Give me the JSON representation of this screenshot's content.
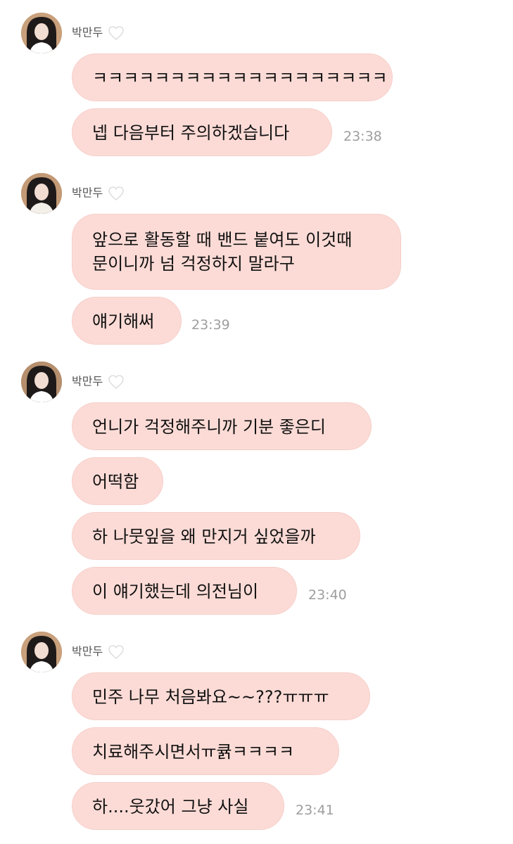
{
  "groups": [
    {
      "sender": "박만두",
      "messages": [
        {
          "text": "ㅋㅋㅋㅋㅋㅋㅋㅋㅋㅋㅋㅋㅋㅋㅋㅋㅋㅋㅋ"
        },
        {
          "text": "넵 다음부터 주의하겠습니다",
          "time": "23:38"
        }
      ]
    },
    {
      "sender": "박만두",
      "messages": [
        {
          "line1": "앞으로 활동할 때 밴드 붙여도 이것때",
          "line2": "문이니까 넘 걱정하지 말라구"
        },
        {
          "text": "얘기해써",
          "time": "23:39"
        }
      ]
    },
    {
      "sender": "박만두",
      "messages": [
        {
          "text": "언니가 걱정해주니까 기분 좋은디"
        },
        {
          "text": "어떡함"
        },
        {
          "text": "하 나뭇잎을 왜 만지거 싶었을까"
        },
        {
          "text": "이 얘기했는데 의전님이",
          "time": "23:40"
        }
      ]
    },
    {
      "sender": "박만두",
      "messages": [
        {
          "text": "민주 나무 처음봐요~~???ㅠㅠㅠ"
        },
        {
          "text": "치료해주시면서ㅠ큙ㅋㅋㅋㅋ"
        },
        {
          "text": "하....웃갔어 그냥 사실",
          "time": "23:41"
        }
      ]
    }
  ],
  "colors": {
    "bubble": "#fcdbd6",
    "bubble_border": "#f6cfca",
    "text": "#111111",
    "sender": "#555555",
    "time": "#9e9e9e"
  },
  "icons": {
    "heart": "white-heart-icon",
    "avatar": "profile-avatar"
  }
}
